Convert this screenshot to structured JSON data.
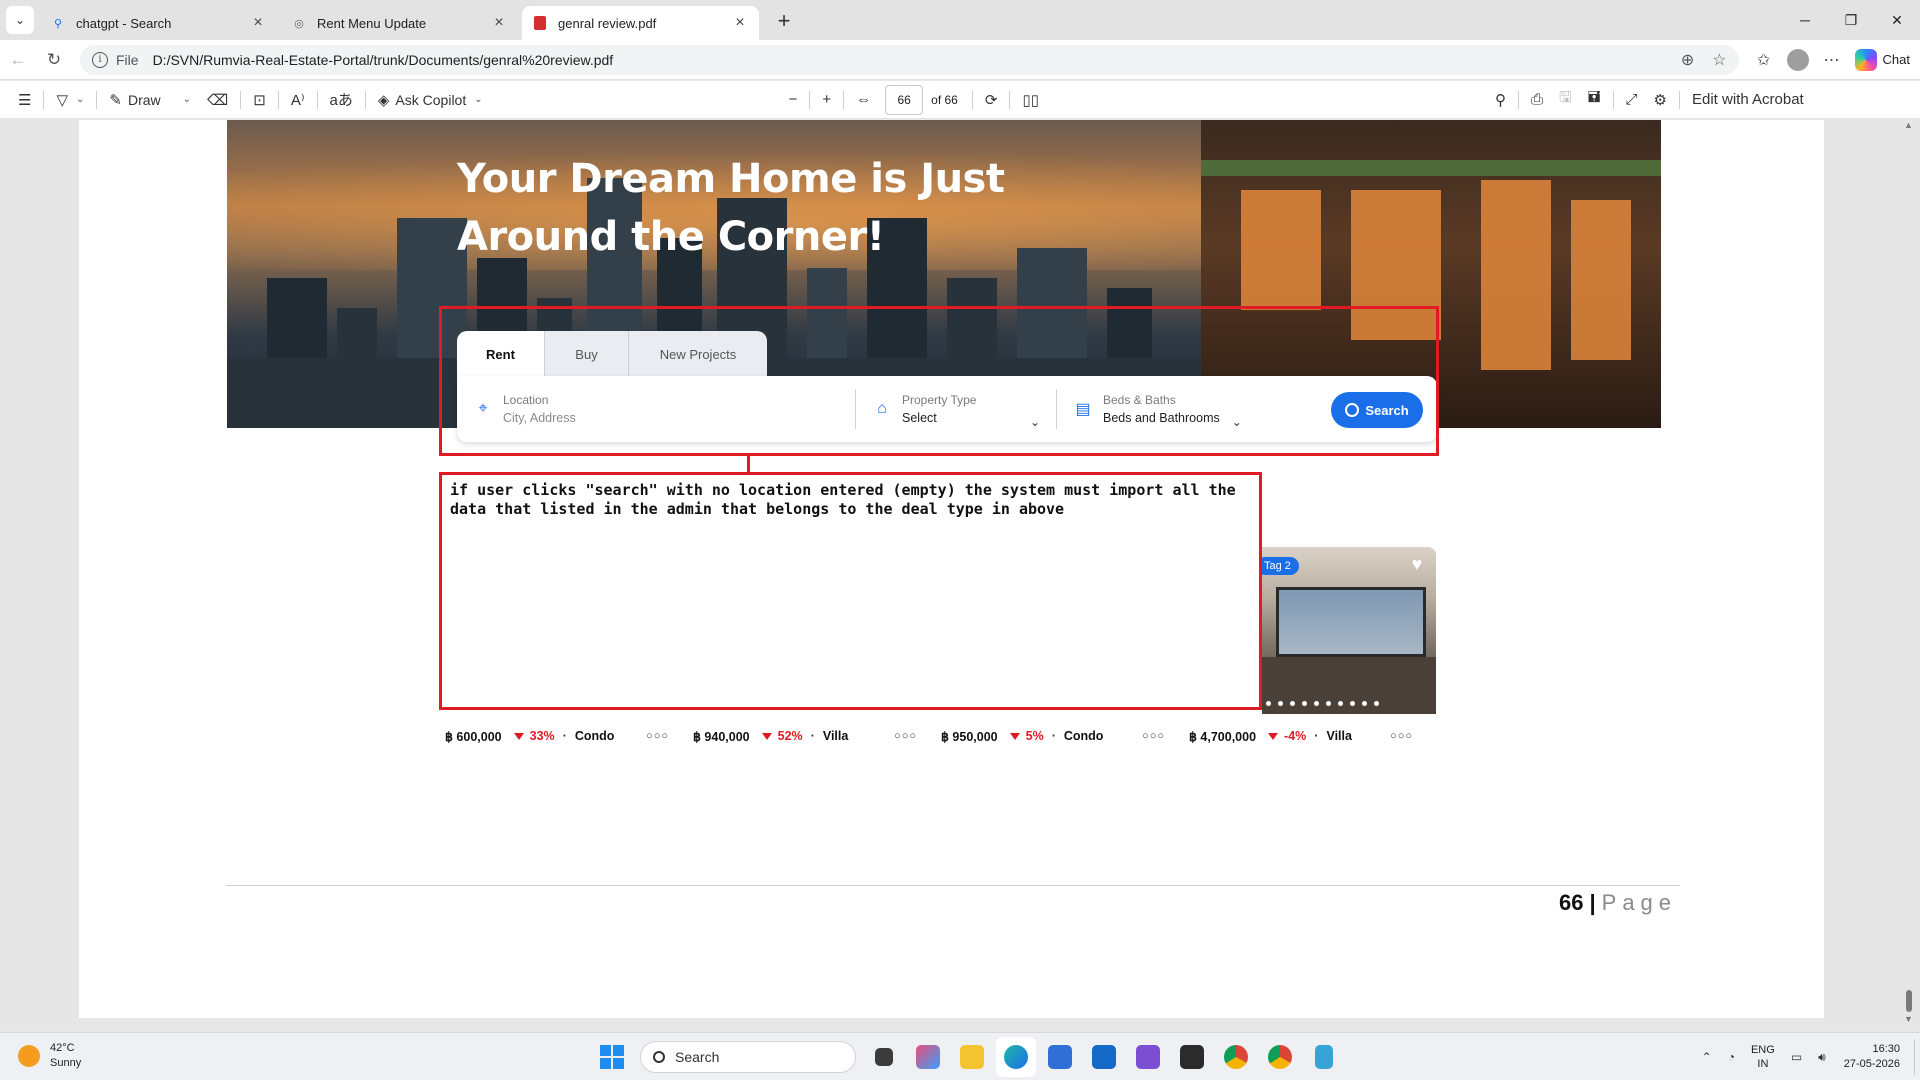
{
  "browser": {
    "tabs": [
      {
        "title": "chatgpt - Search",
        "icon": "search-icon"
      },
      {
        "title": "Rent Menu Update",
        "icon": "globe-icon"
      },
      {
        "title": "genral review.pdf",
        "icon": "pdf-icon",
        "active": true
      }
    ],
    "address": {
      "scheme_label": "File",
      "url": "D:/SVN/Rumvia-Real-Estate-Portal/trunk/Documents/genral%20review.pdf"
    },
    "chat_label": "Chat"
  },
  "pdf_toolbar": {
    "draw_label": "Draw",
    "ask_copilot_label": "Ask Copilot",
    "page_current": "66",
    "page_total_label": "of 66",
    "edit_label": "Edit with Acrobat"
  },
  "document": {
    "hero_title": "Your Dream Home is Just Around the Corner!",
    "search_tabs": [
      "Rent",
      "Buy",
      "New Projects"
    ],
    "location": {
      "label": "Location",
      "placeholder": "City, Address"
    },
    "property_type": {
      "label": "Property Type",
      "value": "Select"
    },
    "beds_baths": {
      "label": "Beds & Baths",
      "value": "Beds and Bathrooms"
    },
    "search_button": "Search",
    "annotation": "if user clicks \"search\" with  no location entered (empty) the system must import all the data that listed in the admin that belongs to the deal type in above",
    "property_tag": "Tag 2",
    "listings": [
      {
        "price": "฿ 600,000",
        "change": "33%",
        "type": "Condo"
      },
      {
        "price": "฿ 940,000",
        "change": "52%",
        "type": "Villa"
      },
      {
        "price": "฿ 950,000",
        "change": "5%",
        "type": "Condo"
      },
      {
        "price": "฿ 4,700,000",
        "change": "-4%",
        "type": "Villa"
      }
    ],
    "page_number": "66",
    "page_word": "Page"
  },
  "taskbar": {
    "weather_temp": "42°C",
    "weather_desc": "Sunny",
    "search_label": "Search",
    "lang_line1": "ENG",
    "lang_line2": "IN",
    "time": "16:30",
    "date": "27-05-2026"
  },
  "colors": {
    "accent_blue": "#1a6fe8",
    "annotation_red": "#e01b24"
  }
}
